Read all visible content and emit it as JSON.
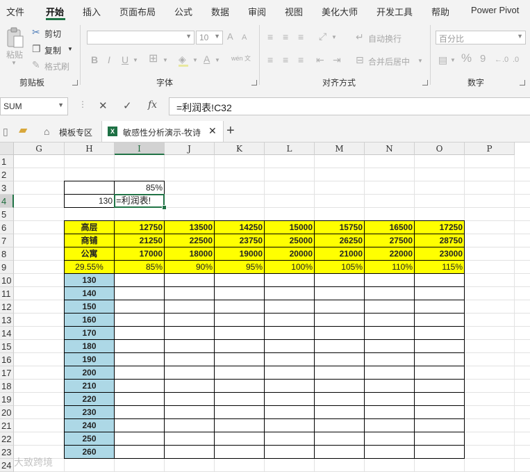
{
  "ribbon_tabs": [
    "文件",
    "开始",
    "插入",
    "页面布局",
    "公式",
    "数据",
    "审阅",
    "视图",
    "美化大师",
    "开发工具",
    "帮助",
    "Power Pivot"
  ],
  "active_tab": "开始",
  "accent_color": "#217346",
  "clipboard": {
    "paste": "粘贴",
    "cut": "剪切",
    "copy": "复制",
    "format_painter": "格式刷",
    "label": "剪贴板"
  },
  "font": {
    "size": "10",
    "label": "字体",
    "bold": "B",
    "italic": "I",
    "underline": "U",
    "grow": "A",
    "shrink": "A",
    "font_color": "A",
    "phonetic": "wén 文"
  },
  "alignment": {
    "wrap": "自动换行",
    "merge": "合并后居中",
    "label": "对齐方式"
  },
  "number": {
    "format": "百分比",
    "label": "数字",
    "percent": "%",
    "comma": "9"
  },
  "formula_bar": {
    "name_box": "SUM",
    "cancel": "✕",
    "enter": "✓",
    "fx": "fx",
    "formula": "=利润表!C32"
  },
  "doc_tabs": {
    "template_zone": "模板专区",
    "active_doc": "敏感性分析演示-牧诗",
    "close": "✕",
    "new": "+"
  },
  "columns": [
    "G",
    "H",
    "I",
    "J",
    "K",
    "L",
    "M",
    "N",
    "O",
    "P"
  ],
  "selected_column": "I",
  "rows": [
    "1",
    "2",
    "3",
    "4",
    "5",
    "6",
    "7",
    "8",
    "9",
    "10",
    "11",
    "12",
    "13",
    "14",
    "15",
    "16",
    "17",
    "18",
    "19",
    "20",
    "21",
    "22",
    "23",
    "24"
  ],
  "selected_row": "4",
  "cells": {
    "I3": "85%",
    "H4": "130",
    "I4": "=利润表!"
  },
  "highlight_yellow": "#ffff00",
  "highlight_blue": "#add8e6",
  "table": {
    "rows": [
      {
        "label": "高层",
        "values": [
          "12750",
          "13500",
          "14250",
          "15000",
          "15750",
          "16500",
          "17250"
        ]
      },
      {
        "label": "商铺",
        "values": [
          "21250",
          "22500",
          "23750",
          "25000",
          "26250",
          "27500",
          "28750"
        ]
      },
      {
        "label": "公寓",
        "values": [
          "17000",
          "18000",
          "19000",
          "20000",
          "21000",
          "22000",
          "23000"
        ]
      }
    ],
    "rate_row": {
      "label": "29.55%",
      "values": [
        "85%",
        "90%",
        "95%",
        "100%",
        "105%",
        "110%",
        "115%"
      ]
    },
    "price_column": [
      "130",
      "140",
      "150",
      "160",
      "170",
      "180",
      "190",
      "200",
      "210",
      "220",
      "230",
      "240",
      "250",
      "260"
    ]
  },
  "watermark": "大致跨境"
}
